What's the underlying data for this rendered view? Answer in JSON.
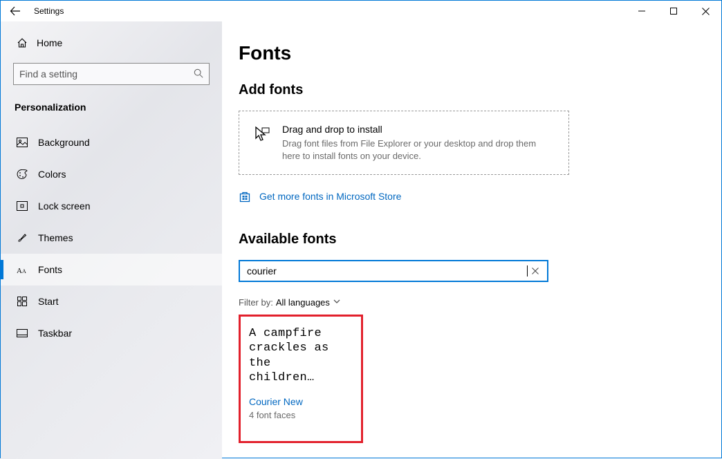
{
  "titlebar": {
    "title": "Settings"
  },
  "sidebar": {
    "home_label": "Home",
    "search_placeholder": "Find a setting",
    "category": "Personalization",
    "items": [
      {
        "label": "Background"
      },
      {
        "label": "Colors"
      },
      {
        "label": "Lock screen"
      },
      {
        "label": "Themes"
      },
      {
        "label": "Fonts"
      },
      {
        "label": "Start"
      },
      {
        "label": "Taskbar"
      }
    ]
  },
  "page": {
    "title": "Fonts",
    "add_fonts_title": "Add fonts",
    "dropzone_title": "Drag and drop to install",
    "dropzone_sub": "Drag font files from File Explorer or your desktop and drop them here to install fonts on your device.",
    "store_link": "Get more fonts in Microsoft Store",
    "available_title": "Available fonts",
    "search_value": "courier",
    "filter_label": "Filter by:",
    "filter_value": "All languages",
    "card": {
      "sample": "A campfire\ncrackles as\nthe\nchildren…",
      "name": "Courier New",
      "faces": "4 font faces"
    }
  }
}
